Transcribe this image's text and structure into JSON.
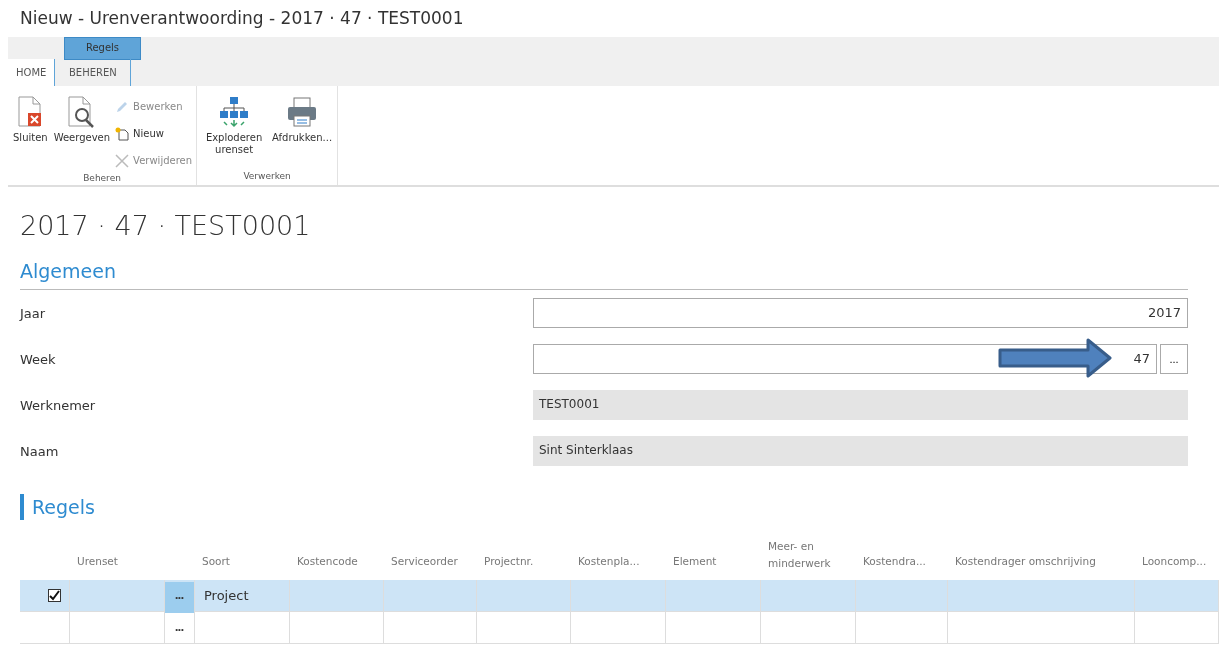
{
  "window": {
    "title": "Nieuw - Urenverantwoording - 2017 · 47 · TEST0001"
  },
  "ribbon": {
    "context_group": "Regels",
    "tabs": [
      {
        "label": "HOME",
        "selected": true,
        "contextual": false
      },
      {
        "label": "BEHEREN",
        "selected": false,
        "contextual": true
      }
    ],
    "groups": [
      {
        "label": "Beheren",
        "buttons": [
          {
            "label": "Sluiten",
            "kind": "large",
            "disabled": false
          },
          {
            "label": "Weergeven",
            "kind": "large",
            "disabled": false
          },
          {
            "label": "Bewerken",
            "kind": "small",
            "disabled": true
          },
          {
            "label": "Nieuw",
            "kind": "small",
            "disabled": false
          },
          {
            "label": "Verwijderen",
            "kind": "small",
            "disabled": true
          }
        ]
      },
      {
        "label": "Verwerken",
        "buttons": [
          {
            "label": "Exploderen urenset",
            "kind": "large",
            "disabled": false
          },
          {
            "label": "Afdrukken...",
            "kind": "large",
            "disabled": false
          }
        ]
      }
    ]
  },
  "page_title": "2017 · 47 · TEST0001",
  "general": {
    "heading": "Algemeen",
    "fields": [
      {
        "label": "Jaar",
        "value": "2017",
        "kind": "number"
      },
      {
        "label": "Week",
        "value": "47",
        "kind": "lookup",
        "button": "...",
        "annotated": true
      },
      {
        "label": "Werknemer",
        "value": "TEST0001",
        "kind": "readonly"
      },
      {
        "label": "Naam",
        "value": "Sint Sinterklaas",
        "kind": "readonly"
      }
    ]
  },
  "lines": {
    "heading": "Regels",
    "columns": [
      "Urenset",
      "Soort",
      "Kostencode",
      "Serviceorder",
      "Projectnr.",
      "Kostenpla...",
      "Element",
      "Meer- en minderwerk",
      "Kostendra...",
      "Kostendrager omschrijving",
      "Looncomp..."
    ],
    "rows": [
      {
        "kind": "line",
        "selected": true,
        "checked": true,
        "menu": "•••",
        "cells": [
          "",
          "Project",
          "",
          "",
          "",
          "",
          "",
          "",
          "",
          "",
          ""
        ]
      },
      {
        "kind": "new",
        "selected": false,
        "menu": "•••",
        "cells": [
          "",
          "",
          "",
          "",
          "",
          "",
          "",
          "",
          "",
          "",
          ""
        ]
      }
    ]
  }
}
